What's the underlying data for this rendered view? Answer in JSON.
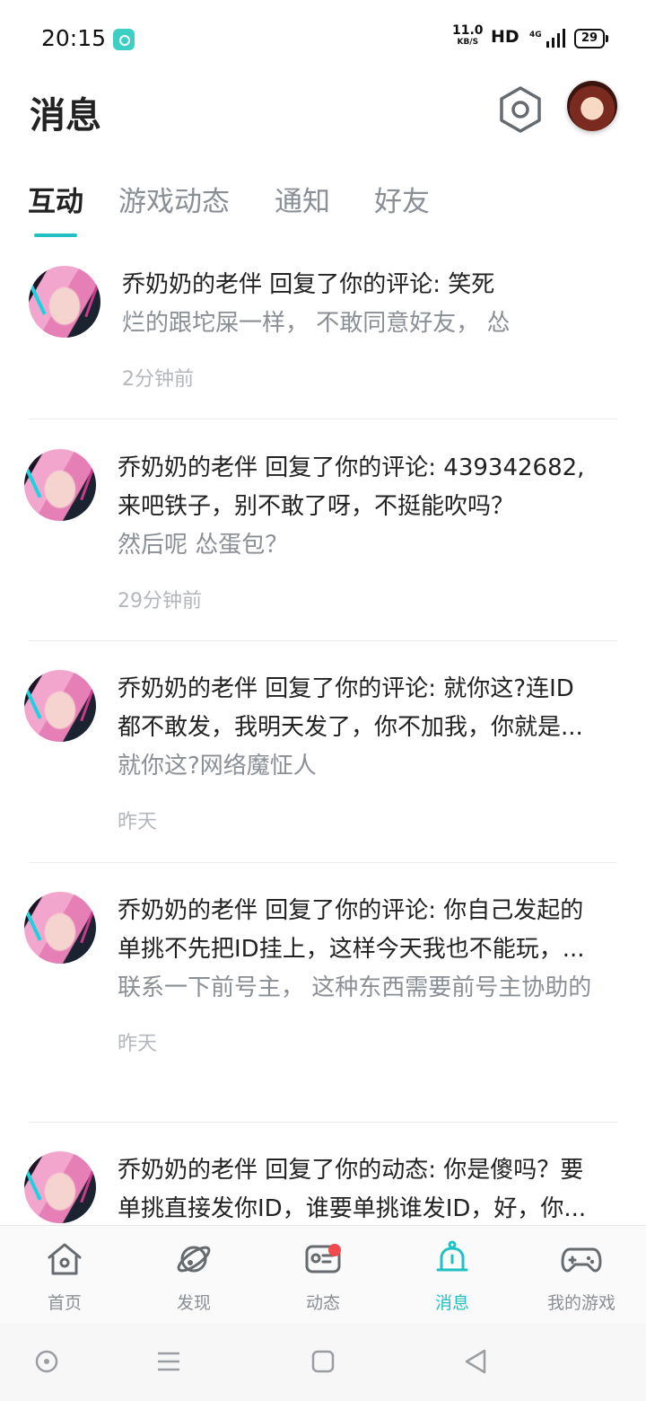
{
  "status_bar": {
    "time": "20:15",
    "net_speed": "11.0",
    "net_unit": "KB/S",
    "hd": "HD",
    "network": "4G",
    "battery": "29"
  },
  "header": {
    "title": "消息"
  },
  "tabs": [
    {
      "label": "互动",
      "active": true
    },
    {
      "label": "游戏动态",
      "active": false
    },
    {
      "label": "通知",
      "active": false
    },
    {
      "label": "好友",
      "active": false
    }
  ],
  "messages": [
    {
      "lines": [
        "乔奶奶的老伴 回复了你的评论: 笑死"
      ],
      "quote": "烂的跟坨屎一样， 不敢同意好友， 怂",
      "time": "2分钟前"
    },
    {
      "lines": [
        "乔奶奶的老伴 回复了你的评论: 439342682,",
        "来吧铁子，别不敢了呀，不挺能吹吗？"
      ],
      "quote": "然后呢 怂蛋包？",
      "time": "29分钟前"
    },
    {
      "lines": [
        "乔奶奶的老伴 回复了你的评论: 就你这?连ID",
        "都不敢发，我明天发了，你不加我，你就是..."
      ],
      "quote": "就你这?网络魔怔人",
      "time": "昨天"
    },
    {
      "lines": [
        "乔奶奶的老伴 回复了你的评论: 你自己发起的",
        "单挑不先把ID挂上，这样今天我也不能玩，..."
      ],
      "quote": "联系一下前号主， 这种东西需要前号主协助的",
      "time": "昨天"
    },
    {
      "lines": [
        "乔奶奶的老伴 回复了你的动态: 你是傻吗？要",
        "单挑直接发你ID，谁要单挑谁发ID，好，你..."
      ],
      "quote": "",
      "time": ""
    }
  ],
  "bottom_nav": [
    {
      "label": "首页",
      "icon": "home-icon",
      "active": false
    },
    {
      "label": "发现",
      "icon": "planet-icon",
      "active": false
    },
    {
      "label": "动态",
      "icon": "feed-icon",
      "active": false,
      "badge": true
    },
    {
      "label": "消息",
      "icon": "bell-icon",
      "active": true
    },
    {
      "label": "我的游戏",
      "icon": "gamepad-icon",
      "active": false
    }
  ],
  "colors": {
    "accent": "#21c1c3",
    "badge": "#f2494c",
    "muted_text": "#8a8f96"
  }
}
